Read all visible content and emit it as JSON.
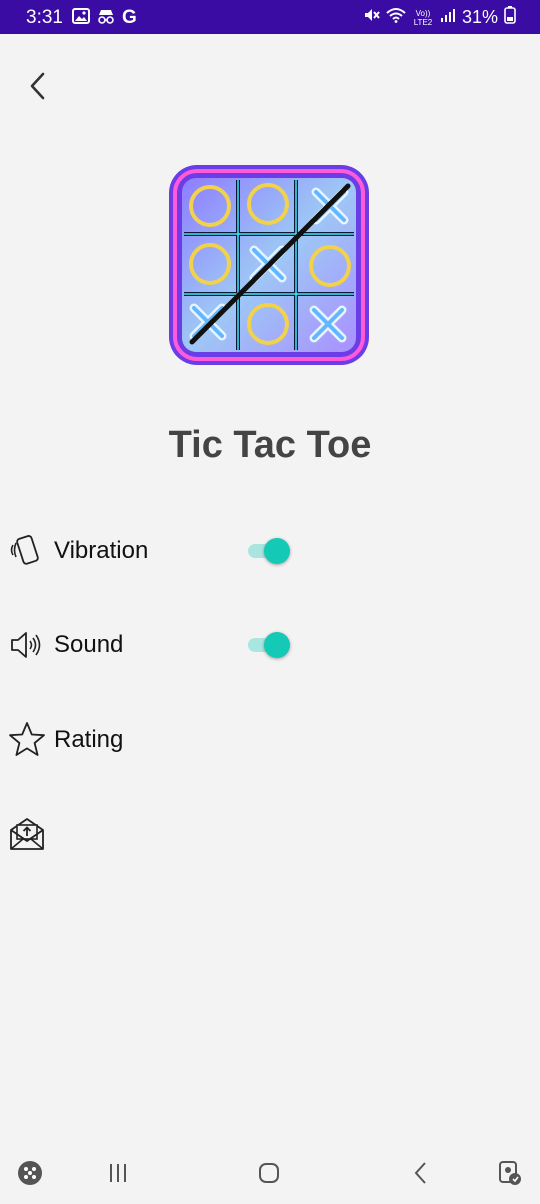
{
  "status_bar": {
    "time": "3:31",
    "battery": "31%",
    "left_icons": [
      "gallery-icon",
      "incognito-icon",
      "google-g-icon"
    ],
    "right_icons": [
      "mute-icon",
      "wifi-icon",
      "volte-icon",
      "signal-icon",
      "battery-icon"
    ],
    "google_letter": "G",
    "volte_text": "Vo)) LTE2"
  },
  "header": {
    "back_icon": "chevron-left-icon"
  },
  "app": {
    "title": "Tic Tac Toe",
    "logo": "tic-tac-toe-logo"
  },
  "settings": {
    "items": [
      {
        "icon": "vibration-phone-icon",
        "label": "Vibration",
        "toggle": true
      },
      {
        "icon": "speaker-icon",
        "label": "Sound",
        "toggle": true
      },
      {
        "icon": "star-outline-icon",
        "label": "Rating"
      },
      {
        "icon": "share-envelope-icon",
        "label": ""
      }
    ]
  },
  "colors": {
    "status_bar": "#3a0ca3",
    "background": "#f3f3f3",
    "toggle_on": "#14c9b5",
    "toggle_track": "#a9e6e0",
    "title": "#444444"
  },
  "nav_bar": {
    "items": [
      "game-launcher-icon",
      "recents-icon",
      "home-icon",
      "back-icon",
      "assistant-icon"
    ]
  }
}
